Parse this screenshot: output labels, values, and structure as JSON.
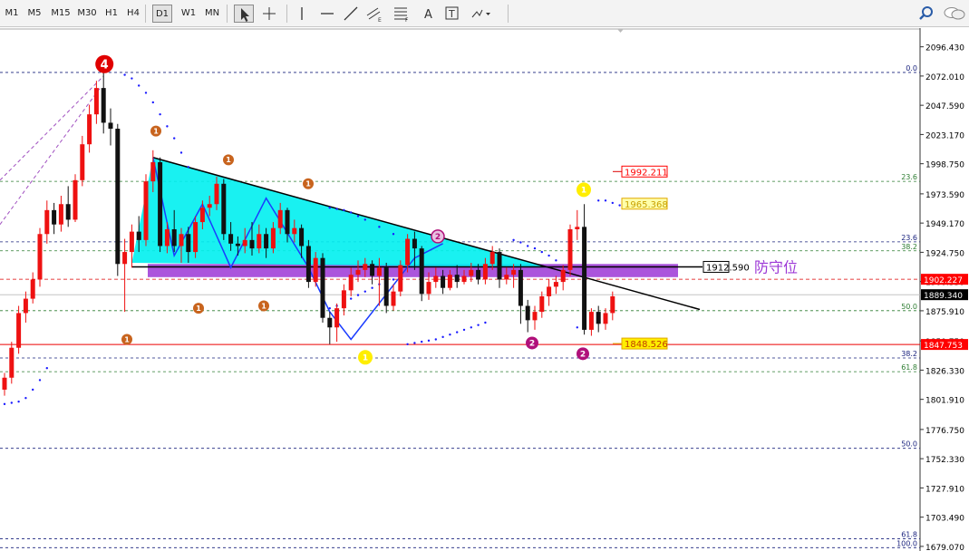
{
  "toolbar": {
    "timeframes": [
      "M1",
      "M5",
      "M15",
      "M30",
      "H1",
      "H4",
      "D1",
      "W1",
      "MN"
    ],
    "active_timeframe": "D1",
    "tools": [
      {
        "name": "cursor-tool",
        "icon": "arrow-cursor"
      },
      {
        "name": "crosshair-tool",
        "icon": "crosshair"
      },
      {
        "name": "vertical-line-tool",
        "icon": "vertical-line"
      },
      {
        "name": "horizontal-line-tool",
        "icon": "horizontal-line"
      },
      {
        "name": "trendline-tool",
        "icon": "trendline"
      },
      {
        "name": "equidistant-channel-tool",
        "icon": "channel",
        "badge": "E"
      },
      {
        "name": "fibonacci-tool",
        "icon": "fibonacci",
        "badge": "F"
      },
      {
        "name": "text-tool",
        "icon": "text",
        "glyph": "A"
      },
      {
        "name": "text-label-tool",
        "icon": "text-label",
        "glyph": "T"
      },
      {
        "name": "shapes-menu",
        "icon": "shapes-dropdown"
      }
    ],
    "right_icons": [
      "search-icon",
      "chat-icon"
    ]
  },
  "chart_data": {
    "type": "candlestick",
    "timeframe": "D1",
    "ylim": [
      1679.0,
      2106.0
    ],
    "y_ticks": [
      "2096.430",
      "2072.010",
      "2047.590",
      "2023.170",
      "1998.750",
      "1973.590",
      "1949.170",
      "1924.750",
      "1900.330",
      "1875.910",
      "1850.750",
      "1826.330",
      "1801.910",
      "1776.750",
      "1752.330",
      "1727.910",
      "1703.490",
      "1679.070"
    ],
    "current_price": "1889.340",
    "price_labels": [
      {
        "text": "1902.227",
        "value": 1902.227,
        "color": "#ff0000"
      },
      {
        "text": "1847.753",
        "value": 1847.753,
        "color": "#ff0000"
      }
    ],
    "annotation_boxes": [
      {
        "text": "1992.211",
        "value": 1992.211,
        "color": "#ff0000"
      },
      {
        "text": "1965.368",
        "value": 1965.368,
        "color": "#e0a800"
      },
      {
        "text": "1912.590",
        "value": 1912.59,
        "color": "#000000"
      },
      {
        "text": "1848.526",
        "value": 1848.526,
        "color": "#e0a800"
      }
    ],
    "defense_label": "防守位",
    "fib_levels": [
      {
        "text": "0.0",
        "value": 2075.0,
        "color": "#1a237e"
      },
      {
        "text": "23.6",
        "value": 1984.0,
        "color": "#2e7d32"
      },
      {
        "text": "23.6",
        "value": 1933.5,
        "color": "#1a237e"
      },
      {
        "text": "38.2",
        "value": 1926.0,
        "color": "#2e7d32"
      },
      {
        "text": "50.0",
        "value": 1876.0,
        "color": "#2e7d32"
      },
      {
        "text": "38.2",
        "value": 1836.5,
        "color": "#1a237e"
      },
      {
        "text": "61.8",
        "value": 1825.0,
        "color": "#2e7d32"
      },
      {
        "text": "50.0",
        "value": 1761.0,
        "color": "#1a237e"
      },
      {
        "text": "61.8",
        "value": 1685.5,
        "color": "#1a237e"
      },
      {
        "text": "100.0",
        "value": 1678.0,
        "color": "#1a237e"
      }
    ],
    "wave_labels": [
      {
        "text": "4",
        "style": "red"
      },
      {
        "text": "1",
        "style": "orange"
      },
      {
        "text": "1",
        "style": "orange"
      },
      {
        "text": "1",
        "style": "orange"
      },
      {
        "text": "1",
        "style": "orange"
      },
      {
        "text": "1",
        "style": "orange"
      },
      {
        "text": "1",
        "style": "orange"
      },
      {
        "text": "2",
        "style": "magenta"
      },
      {
        "text": "2",
        "style": "magenta"
      },
      {
        "text": "2",
        "style": "magenta"
      },
      {
        "text": "1",
        "style": "yellow"
      },
      {
        "text": "1",
        "style": "yellow"
      }
    ],
    "candles": [
      {
        "o": 1810,
        "h": 1824,
        "c": 1820,
        "l": 1805
      },
      {
        "o": 1820,
        "h": 1850,
        "c": 1845,
        "l": 1815
      },
      {
        "o": 1845,
        "h": 1880,
        "c": 1874,
        "l": 1840
      },
      {
        "o": 1874,
        "h": 1892,
        "c": 1886,
        "l": 1866
      },
      {
        "o": 1886,
        "h": 1908,
        "c": 1902,
        "l": 1882
      },
      {
        "o": 1902,
        "h": 1945,
        "c": 1940,
        "l": 1896
      },
      {
        "o": 1940,
        "h": 1968,
        "c": 1960,
        "l": 1932
      },
      {
        "o": 1960,
        "h": 1966,
        "c": 1948,
        "l": 1940
      },
      {
        "o": 1948,
        "h": 1972,
        "c": 1965,
        "l": 1942
      },
      {
        "o": 1965,
        "h": 1980,
        "c": 1952,
        "l": 1946
      },
      {
        "o": 1952,
        "h": 1990,
        "c": 1985,
        "l": 1950
      },
      {
        "o": 1985,
        "h": 2022,
        "c": 2015,
        "l": 1980
      },
      {
        "o": 2015,
        "h": 2048,
        "c": 2040,
        "l": 2008
      },
      {
        "o": 2040,
        "h": 2068,
        "c": 2062,
        "l": 2032
      },
      {
        "o": 2062,
        "h": 2075,
        "c": 2033,
        "l": 2024
      },
      {
        "o": 2033,
        "h": 2045,
        "c": 2028,
        "l": 2014
      },
      {
        "o": 2028,
        "h": 2032,
        "c": 1915,
        "l": 1905
      },
      {
        "o": 1915,
        "h": 1936,
        "c": 1925,
        "l": 1875
      },
      {
        "o": 1925,
        "h": 1948,
        "c": 1942,
        "l": 1912
      },
      {
        "o": 1942,
        "h": 1955,
        "c": 1935,
        "l": 1925
      },
      {
        "o": 1935,
        "h": 1990,
        "c": 1984,
        "l": 1930
      },
      {
        "o": 1984,
        "h": 2010,
        "c": 2000,
        "l": 1975
      },
      {
        "o": 2000,
        "h": 2004,
        "c": 1930,
        "l": 1925
      },
      {
        "o": 1930,
        "h": 1950,
        "c": 1944,
        "l": 1924
      },
      {
        "o": 1944,
        "h": 1960,
        "c": 1930,
        "l": 1925
      },
      {
        "o": 1930,
        "h": 1945,
        "c": 1940,
        "l": 1916
      },
      {
        "o": 1940,
        "h": 1946,
        "c": 1925,
        "l": 1916
      },
      {
        "o": 1925,
        "h": 1955,
        "c": 1950,
        "l": 1920
      },
      {
        "o": 1950,
        "h": 1968,
        "c": 1962,
        "l": 1944
      },
      {
        "o": 1962,
        "h": 1972,
        "c": 1965,
        "l": 1955
      },
      {
        "o": 1965,
        "h": 1988,
        "c": 1982,
        "l": 1960
      },
      {
        "o": 1982,
        "h": 1986,
        "c": 1940,
        "l": 1935
      },
      {
        "o": 1940,
        "h": 1950,
        "c": 1932,
        "l": 1926
      },
      {
        "o": 1932,
        "h": 1938,
        "c": 1930,
        "l": 1922
      },
      {
        "o": 1930,
        "h": 1945,
        "c": 1935,
        "l": 1924
      },
      {
        "o": 1935,
        "h": 1950,
        "c": 1928,
        "l": 1922
      },
      {
        "o": 1928,
        "h": 1948,
        "c": 1940,
        "l": 1924
      },
      {
        "o": 1940,
        "h": 1945,
        "c": 1928,
        "l": 1920
      },
      {
        "o": 1928,
        "h": 1950,
        "c": 1945,
        "l": 1924
      },
      {
        "o": 1945,
        "h": 1966,
        "c": 1960,
        "l": 1940
      },
      {
        "o": 1960,
        "h": 1962,
        "c": 1940,
        "l": 1933
      },
      {
        "o": 1940,
        "h": 1952,
        "c": 1945,
        "l": 1933
      },
      {
        "o": 1945,
        "h": 1948,
        "c": 1930,
        "l": 1920
      },
      {
        "o": 1930,
        "h": 1935,
        "c": 1900,
        "l": 1895
      },
      {
        "o": 1900,
        "h": 1925,
        "c": 1920,
        "l": 1896
      },
      {
        "o": 1920,
        "h": 1924,
        "c": 1870,
        "l": 1866
      },
      {
        "o": 1870,
        "h": 1875,
        "c": 1862,
        "l": 1848
      },
      {
        "o": 1862,
        "h": 1882,
        "c": 1878,
        "l": 1850
      },
      {
        "o": 1878,
        "h": 1898,
        "c": 1893,
        "l": 1872
      },
      {
        "o": 1893,
        "h": 1912,
        "c": 1906,
        "l": 1888
      },
      {
        "o": 1906,
        "h": 1918,
        "c": 1910,
        "l": 1900
      },
      {
        "o": 1910,
        "h": 1920,
        "c": 1915,
        "l": 1904
      },
      {
        "o": 1915,
        "h": 1918,
        "c": 1905,
        "l": 1898
      },
      {
        "o": 1905,
        "h": 1920,
        "c": 1912,
        "l": 1880
      },
      {
        "o": 1912,
        "h": 1916,
        "c": 1880,
        "l": 1874
      },
      {
        "o": 1880,
        "h": 1898,
        "c": 1892,
        "l": 1876
      },
      {
        "o": 1892,
        "h": 1918,
        "c": 1914,
        "l": 1888
      },
      {
        "o": 1914,
        "h": 1940,
        "c": 1936,
        "l": 1908
      },
      {
        "o": 1936,
        "h": 1942,
        "c": 1928,
        "l": 1910
      },
      {
        "o": 1928,
        "h": 1930,
        "c": 1890,
        "l": 1884
      },
      {
        "o": 1890,
        "h": 1908,
        "c": 1900,
        "l": 1885
      },
      {
        "o": 1900,
        "h": 1912,
        "c": 1905,
        "l": 1895
      },
      {
        "o": 1905,
        "h": 1910,
        "c": 1895,
        "l": 1890
      },
      {
        "o": 1895,
        "h": 1910,
        "c": 1906,
        "l": 1893
      },
      {
        "o": 1906,
        "h": 1914,
        "c": 1900,
        "l": 1895
      },
      {
        "o": 1900,
        "h": 1910,
        "c": 1905,
        "l": 1898
      },
      {
        "o": 1905,
        "h": 1916,
        "c": 1910,
        "l": 1900
      },
      {
        "o": 1910,
        "h": 1915,
        "c": 1902,
        "l": 1898
      },
      {
        "o": 1902,
        "h": 1920,
        "c": 1915,
        "l": 1898
      },
      {
        "o": 1915,
        "h": 1930,
        "c": 1925,
        "l": 1910
      },
      {
        "o": 1925,
        "h": 1928,
        "c": 1902,
        "l": 1895
      },
      {
        "o": 1902,
        "h": 1912,
        "c": 1906,
        "l": 1898
      },
      {
        "o": 1906,
        "h": 1915,
        "c": 1910,
        "l": 1895
      },
      {
        "o": 1910,
        "h": 1915,
        "c": 1880,
        "l": 1865
      },
      {
        "o": 1880,
        "h": 1885,
        "c": 1868,
        "l": 1858
      },
      {
        "o": 1868,
        "h": 1880,
        "c": 1875,
        "l": 1860
      },
      {
        "o": 1875,
        "h": 1892,
        "c": 1888,
        "l": 1870
      },
      {
        "o": 1888,
        "h": 1902,
        "c": 1896,
        "l": 1880
      },
      {
        "o": 1896,
        "h": 1905,
        "c": 1900,
        "l": 1890
      },
      {
        "o": 1900,
        "h": 1914,
        "c": 1910,
        "l": 1893
      },
      {
        "o": 1910,
        "h": 1948,
        "c": 1944,
        "l": 1905
      },
      {
        "o": 1944,
        "h": 1960,
        "c": 1946,
        "l": 1935
      },
      {
        "o": 1946,
        "h": 1965,
        "c": 1860,
        "l": 1856
      },
      {
        "o": 1860,
        "h": 1878,
        "c": 1875,
        "l": 1855
      },
      {
        "o": 1875,
        "h": 1880,
        "c": 1865,
        "l": 1858
      },
      {
        "o": 1865,
        "h": 1878,
        "c": 1874,
        "l": 1860
      },
      {
        "o": 1874,
        "h": 1892,
        "c": 1888,
        "l": 1868
      }
    ]
  }
}
